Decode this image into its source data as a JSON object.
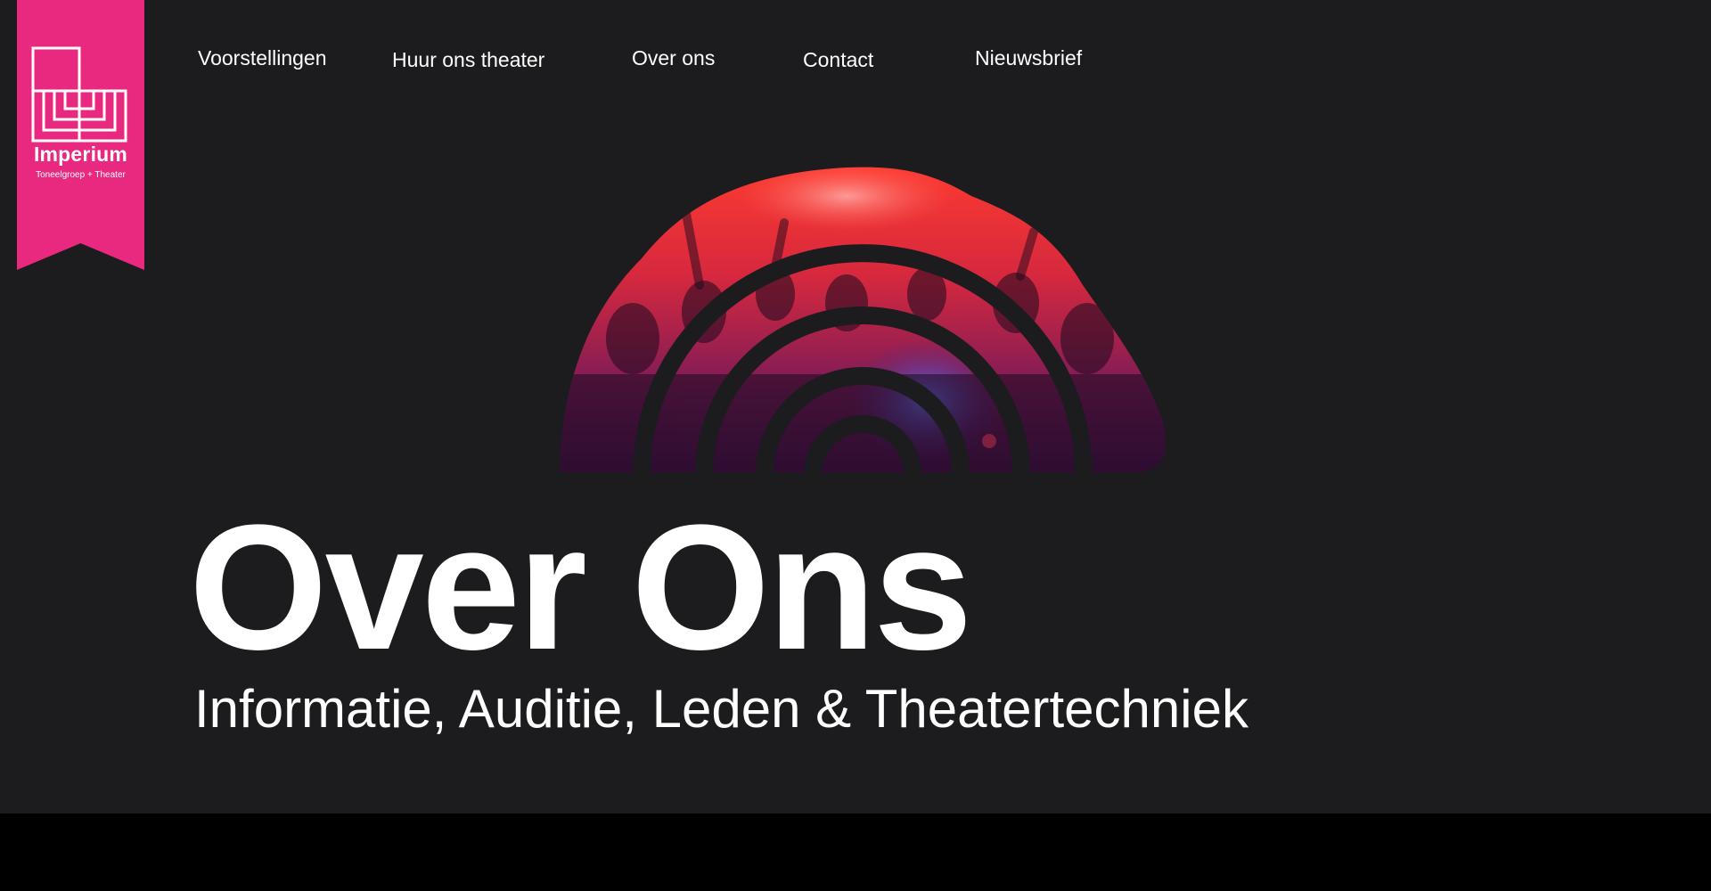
{
  "brand": {
    "name": "Imperium",
    "tagline": "Toneelgroep + Theater",
    "logo_icon": "imperium-logo-icon",
    "accent_color": "#e8297f"
  },
  "nav": {
    "items": [
      {
        "label": "Voorstellingen"
      },
      {
        "label": "Huur ons theater"
      },
      {
        "label": "Over ons"
      },
      {
        "label": "Contact"
      },
      {
        "label": "Nieuwsbrief"
      }
    ]
  },
  "hero": {
    "image_icon": "concert-crowd-arch-image",
    "title": "Over Ons",
    "subtitle": "Informatie, Auditie, Leden & Theatertechniek"
  },
  "colors": {
    "background": "#1c1c1e",
    "footer_band": "#000000",
    "text": "#ffffff"
  }
}
